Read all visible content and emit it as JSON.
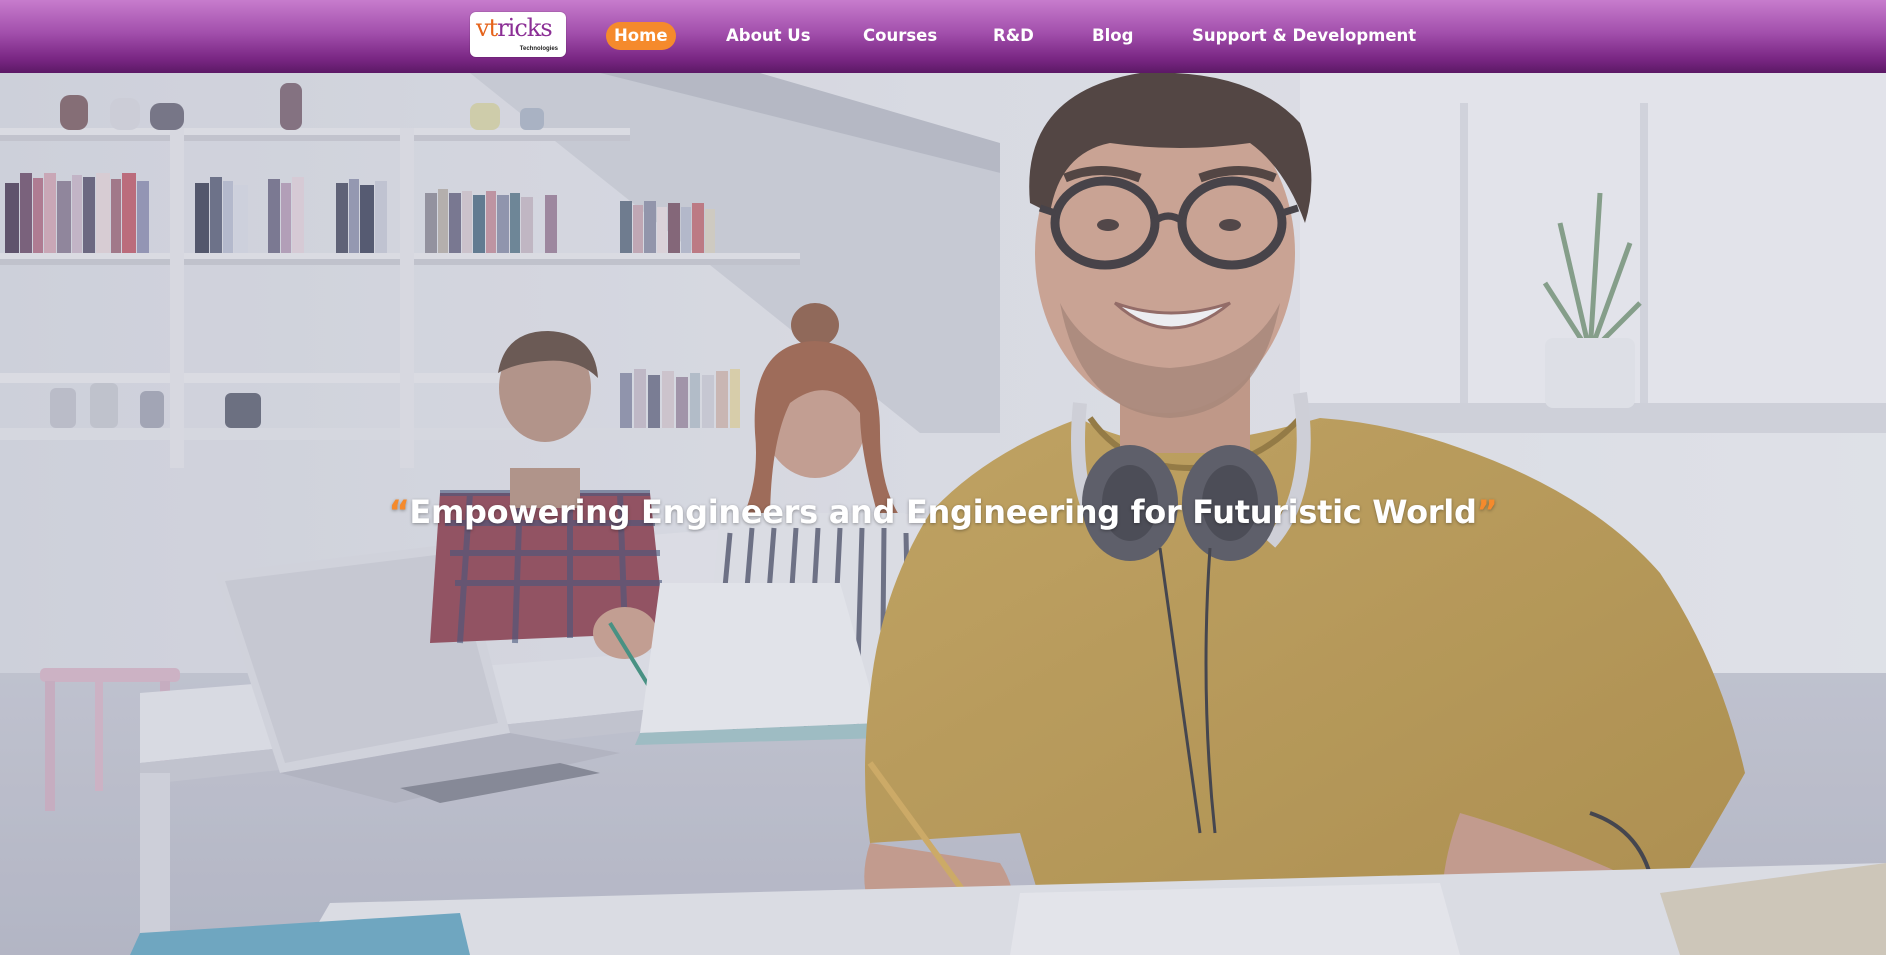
{
  "brand": {
    "logo_word_a": "vt",
    "logo_word_b": "ricks",
    "logo_sub": "Technologies",
    "colors": {
      "orange": "#e5631b",
      "purple": "#8b2e95"
    }
  },
  "nav": {
    "items": [
      {
        "label": "Home",
        "active": true
      },
      {
        "label": "About Us"
      },
      {
        "label": "Courses"
      },
      {
        "label": "R&D"
      },
      {
        "label": "Blog"
      },
      {
        "label": "Support & Development"
      }
    ],
    "colors": {
      "bar_top": "#c77ccd",
      "bar_bottom": "#5c1966",
      "active_pill": "#f58a2c"
    }
  },
  "hero": {
    "quote_open": "“",
    "tagline": "Empowering Engineers and Engineering for Futuristic World",
    "quote_close": "”",
    "quote_color": "#f58a2c"
  }
}
